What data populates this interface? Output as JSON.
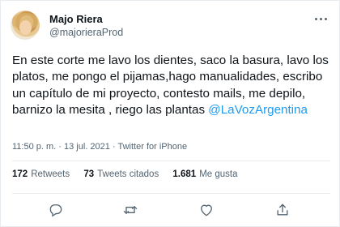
{
  "author": {
    "name": "Majo Riera",
    "handle": "@majorieraProd"
  },
  "tweet": {
    "text": "En este corte me lavo los dientes, saco la basura, lavo los platos, me pongo el pijamas,hago manualidades, escribo un capítulo de mi proyecto, contesto mails, me depilo, barnizo la mesita , riego las plantas",
    "mention": "@LaVozArgentina",
    "time": "11:50 p. m.",
    "separator1": "·",
    "date": "13 jul. 2021",
    "separator2": "·",
    "source": "Twitter for iPhone"
  },
  "stats": {
    "retweets_count": "172",
    "retweets_label": "Retweets",
    "quotes_count": "73",
    "quotes_label": "Tweets citados",
    "likes_count": "1.681",
    "likes_label": "Me gusta"
  },
  "icons": {
    "reply": "reply-icon",
    "retweet": "retweet-icon",
    "like": "heart-icon",
    "share": "share-icon",
    "more": "more-options-icon"
  },
  "colors": {
    "link": "#1d9bf0",
    "secondary_text": "#536471",
    "primary_text": "#0f1419"
  }
}
